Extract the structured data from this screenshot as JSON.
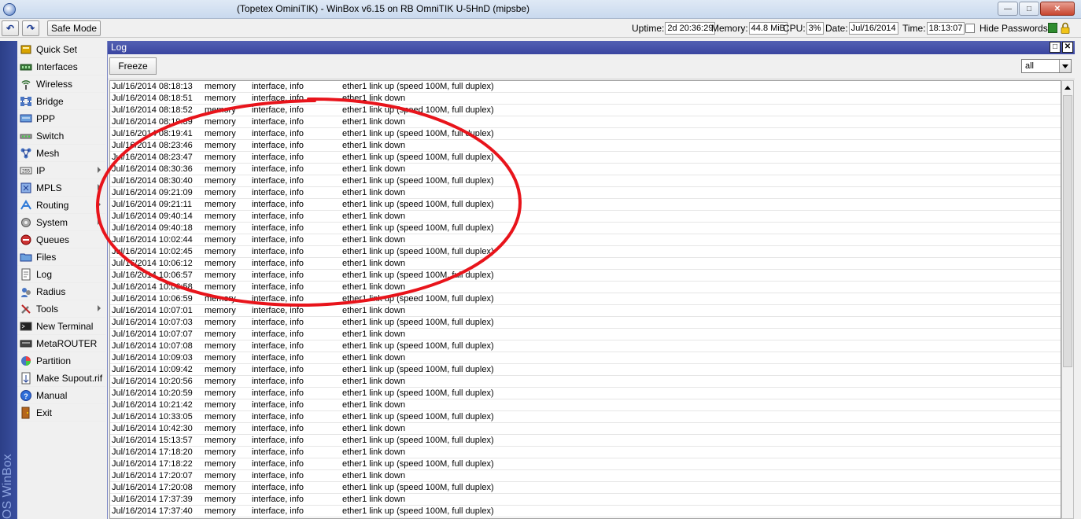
{
  "window": {
    "title": "(Topetex OminiTIK) - WinBox v6.15 on RB OmniTIK U-5HnD (mipsbe)",
    "min_glyph": "—",
    "max_glyph": "□",
    "close_glyph": "✕"
  },
  "toolbar": {
    "undo_glyph": "↶",
    "redo_glyph": "↷",
    "safe_mode": "Safe Mode",
    "uptime_label": "Uptime:",
    "uptime": "2d 20:36:29",
    "memory_label": "Memory:",
    "memory": "44.8 MiB",
    "cpu_label": "CPU:",
    "cpu": "3%",
    "date_label": "Date:",
    "date": "Jul/16/2014",
    "time_label": "Time:",
    "time": "18:13:07",
    "hide_passwords": "Hide Passwords",
    "status_color": "#2f8c2f"
  },
  "brand": "OS WinBox",
  "sidebar": {
    "items": [
      {
        "label": "Quick Set",
        "icon": "quick-set-icon",
        "submenu": false
      },
      {
        "label": "Interfaces",
        "icon": "interfaces-icon",
        "submenu": false
      },
      {
        "label": "Wireless",
        "icon": "wireless-icon",
        "submenu": false
      },
      {
        "label": "Bridge",
        "icon": "bridge-icon",
        "submenu": false
      },
      {
        "label": "PPP",
        "icon": "ppp-icon",
        "submenu": false
      },
      {
        "label": "Switch",
        "icon": "switch-icon",
        "submenu": false
      },
      {
        "label": "Mesh",
        "icon": "mesh-icon",
        "submenu": false
      },
      {
        "label": "IP",
        "icon": "ip-icon",
        "submenu": true
      },
      {
        "label": "MPLS",
        "icon": "mpls-icon",
        "submenu": true
      },
      {
        "label": "Routing",
        "icon": "routing-icon",
        "submenu": true
      },
      {
        "label": "System",
        "icon": "system-icon",
        "submenu": true
      },
      {
        "label": "Queues",
        "icon": "queues-icon",
        "submenu": false
      },
      {
        "label": "Files",
        "icon": "files-icon",
        "submenu": false
      },
      {
        "label": "Log",
        "icon": "log-icon",
        "submenu": false
      },
      {
        "label": "Radius",
        "icon": "radius-icon",
        "submenu": false
      },
      {
        "label": "Tools",
        "icon": "tools-icon",
        "submenu": true
      },
      {
        "label": "New Terminal",
        "icon": "terminal-icon",
        "submenu": false
      },
      {
        "label": "MetaROUTER",
        "icon": "metarouter-icon",
        "submenu": false
      },
      {
        "label": "Partition",
        "icon": "partition-icon",
        "submenu": false
      },
      {
        "label": "Make Supout.rif",
        "icon": "supout-icon",
        "submenu": false
      },
      {
        "label": "Manual",
        "icon": "manual-icon",
        "submenu": false
      },
      {
        "label": "Exit",
        "icon": "exit-icon",
        "submenu": false
      }
    ]
  },
  "log": {
    "title": "Log",
    "restore_glyph": "□",
    "close_glyph": "✕",
    "freeze": "Freeze",
    "filter_value": "all",
    "rows": [
      [
        "Jul/16/2014 08:18:13",
        "memory",
        "interface, info",
        "ether1 link up (speed 100M, full duplex)"
      ],
      [
        "Jul/16/2014 08:18:51",
        "memory",
        "interface, info",
        "ether1 link down"
      ],
      [
        "Jul/16/2014 08:18:52",
        "memory",
        "interface, info",
        "ether1 link up (speed 100M, full duplex)"
      ],
      [
        "Jul/16/2014 08:19:39",
        "memory",
        "interface, info",
        "ether1 link down"
      ],
      [
        "Jul/16/2014 08:19:41",
        "memory",
        "interface, info",
        "ether1 link up (speed 100M, full duplex)"
      ],
      [
        "Jul/16/2014 08:23:46",
        "memory",
        "interface, info",
        "ether1 link down"
      ],
      [
        "Jul/16/2014 08:23:47",
        "memory",
        "interface, info",
        "ether1 link up (speed 100M, full duplex)"
      ],
      [
        "Jul/16/2014 08:30:36",
        "memory",
        "interface, info",
        "ether1 link down"
      ],
      [
        "Jul/16/2014 08:30:40",
        "memory",
        "interface, info",
        "ether1 link up (speed 100M, full duplex)"
      ],
      [
        "Jul/16/2014 09:21:09",
        "memory",
        "interface, info",
        "ether1 link down"
      ],
      [
        "Jul/16/2014 09:21:11",
        "memory",
        "interface, info",
        "ether1 link up (speed 100M, full duplex)"
      ],
      [
        "Jul/16/2014 09:40:14",
        "memory",
        "interface, info",
        "ether1 link down"
      ],
      [
        "Jul/16/2014 09:40:18",
        "memory",
        "interface, info",
        "ether1 link up (speed 100M, full duplex)"
      ],
      [
        "Jul/16/2014 10:02:44",
        "memory",
        "interface, info",
        "ether1 link down"
      ],
      [
        "Jul/16/2014 10:02:45",
        "memory",
        "interface, info",
        "ether1 link up (speed 100M, full duplex)"
      ],
      [
        "Jul/16/2014 10:06:12",
        "memory",
        "interface, info",
        "ether1 link down"
      ],
      [
        "Jul/16/2014 10:06:57",
        "memory",
        "interface, info",
        "ether1 link up (speed 100M, full duplex)"
      ],
      [
        "Jul/16/2014 10:06:58",
        "memory",
        "interface, info",
        "ether1 link down"
      ],
      [
        "Jul/16/2014 10:06:59",
        "memory",
        "interface, info",
        "ether1 link up (speed 100M, full duplex)"
      ],
      [
        "Jul/16/2014 10:07:01",
        "memory",
        "interface, info",
        "ether1 link down"
      ],
      [
        "Jul/16/2014 10:07:03",
        "memory",
        "interface, info",
        "ether1 link up (speed 100M, full duplex)"
      ],
      [
        "Jul/16/2014 10:07:07",
        "memory",
        "interface, info",
        "ether1 link down"
      ],
      [
        "Jul/16/2014 10:07:08",
        "memory",
        "interface, info",
        "ether1 link up (speed 100M, full duplex)"
      ],
      [
        "Jul/16/2014 10:09:03",
        "memory",
        "interface, info",
        "ether1 link down"
      ],
      [
        "Jul/16/2014 10:09:42",
        "memory",
        "interface, info",
        "ether1 link up (speed 100M, full duplex)"
      ],
      [
        "Jul/16/2014 10:20:56",
        "memory",
        "interface, info",
        "ether1 link down"
      ],
      [
        "Jul/16/2014 10:20:59",
        "memory",
        "interface, info",
        "ether1 link up (speed 100M, full duplex)"
      ],
      [
        "Jul/16/2014 10:21:42",
        "memory",
        "interface, info",
        "ether1 link down"
      ],
      [
        "Jul/16/2014 10:33:05",
        "memory",
        "interface, info",
        "ether1 link up (speed 100M, full duplex)"
      ],
      [
        "Jul/16/2014 10:42:30",
        "memory",
        "interface, info",
        "ether1 link down"
      ],
      [
        "Jul/16/2014 15:13:57",
        "memory",
        "interface, info",
        "ether1 link up (speed 100M, full duplex)"
      ],
      [
        "Jul/16/2014 17:18:20",
        "memory",
        "interface, info",
        "ether1 link down"
      ],
      [
        "Jul/16/2014 17:18:22",
        "memory",
        "interface, info",
        "ether1 link up (speed 100M, full duplex)"
      ],
      [
        "Jul/16/2014 17:20:07",
        "memory",
        "interface, info",
        "ether1 link down"
      ],
      [
        "Jul/16/2014 17:20:08",
        "memory",
        "interface, info",
        "ether1 link up (speed 100M, full duplex)"
      ],
      [
        "Jul/16/2014 17:37:39",
        "memory",
        "interface, info",
        "ether1 link down"
      ],
      [
        "Jul/16/2014 17:37:40",
        "memory",
        "interface, info",
        "ether1 link up (speed 100M, full duplex)"
      ]
    ]
  },
  "annotation": {
    "color": "#e8141b"
  }
}
